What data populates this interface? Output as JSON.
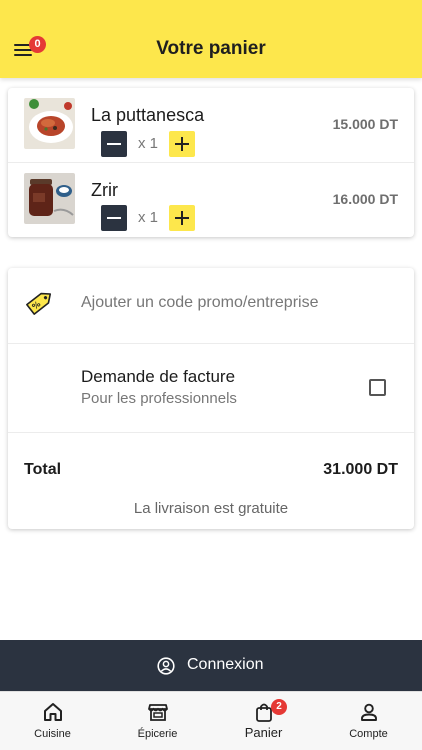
{
  "header": {
    "title": "Votre panier",
    "menu_icon": "hamburger-menu-icon",
    "menu_badge": "0"
  },
  "cart": {
    "items": [
      {
        "name": "La puttanesca",
        "quantity": "x 1",
        "price": "15.000 DT",
        "image": "pasta-dish-photo"
      },
      {
        "name": "Zrir",
        "quantity": "x 1",
        "price": "16.000 DT",
        "image": "zrir-jar-photo"
      }
    ]
  },
  "promo": {
    "icon": "discount-tag-icon",
    "label": "Ajouter un code promo/entreprise"
  },
  "invoice": {
    "title": "Demande de facture",
    "subtitle": "Pour les professionnels",
    "checked": false
  },
  "summary": {
    "total_label": "Total",
    "total_value": "31.000 DT",
    "delivery_note": "La livraison est gratuite"
  },
  "login": {
    "icon": "user-circle-icon",
    "label": "Connexion"
  },
  "tabs": [
    {
      "label": "Cuisine",
      "icon": "home-icon",
      "active": false
    },
    {
      "label": "Épicerie",
      "icon": "store-icon",
      "active": false
    },
    {
      "label": "Panier",
      "icon": "shopping-bag-icon",
      "active": true,
      "badge": "2"
    },
    {
      "label": "Compte",
      "icon": "person-icon",
      "active": false
    }
  ],
  "colors": {
    "accent_yellow": "#fde74c",
    "dark_navy": "#2b3340",
    "badge_red": "#e53935"
  }
}
